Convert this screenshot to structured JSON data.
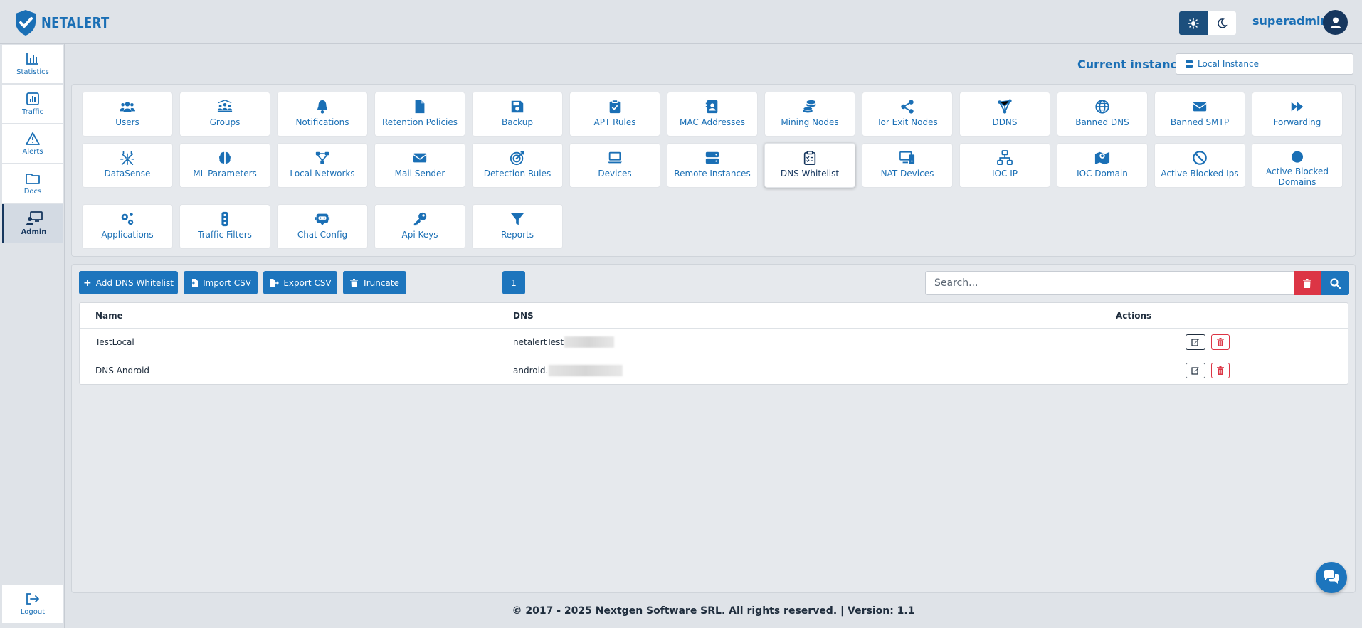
{
  "app": {
    "logo_text": "NETALERT"
  },
  "header": {
    "username": "superadmin"
  },
  "sidebar": {
    "items": [
      {
        "label": "Statistics",
        "icon": "bar-chart-icon"
      },
      {
        "label": "Traffic",
        "icon": "line-chart-icon"
      },
      {
        "label": "Alerts",
        "icon": "warning-icon"
      },
      {
        "label": "Docs",
        "icon": "folder-icon"
      },
      {
        "label": "Admin",
        "icon": "admin-icon",
        "active": true
      }
    ],
    "logout_label": "Logout"
  },
  "instance": {
    "label": "Current instance:",
    "value": "Local Instance"
  },
  "tiles": [
    {
      "label": "Users",
      "icon": "users-icon"
    },
    {
      "label": "Groups",
      "icon": "groups-icon"
    },
    {
      "label": "Notifications",
      "icon": "bell-icon"
    },
    {
      "label": "Retention Policies",
      "icon": "file-icon"
    },
    {
      "label": "Backup",
      "icon": "save-icon"
    },
    {
      "label": "APT Rules",
      "icon": "clipboard-icon"
    },
    {
      "label": "MAC Addresses",
      "icon": "address-book-icon"
    },
    {
      "label": "Mining Nodes",
      "icon": "coins-icon"
    },
    {
      "label": "Tor Exit Nodes",
      "icon": "share-icon"
    },
    {
      "label": "DDNS",
      "icon": "nodes-icon"
    },
    {
      "label": "Banned DNS",
      "icon": "globe-icon"
    },
    {
      "label": "Banned SMTP",
      "icon": "envelope-icon"
    },
    {
      "label": "Forwarding",
      "icon": "forward-icon"
    },
    {
      "label": "DataSense",
      "icon": "sparkle-icon"
    },
    {
      "label": "ML Parameters",
      "icon": "brain-icon"
    },
    {
      "label": "Local Networks",
      "icon": "network-icon"
    },
    {
      "label": "Mail Sender",
      "icon": "envelope-icon"
    },
    {
      "label": "Detection Rules",
      "icon": "target-icon"
    },
    {
      "label": "Devices",
      "icon": "laptop-icon"
    },
    {
      "label": "Remote Instances",
      "icon": "server-icon"
    },
    {
      "label": "DNS Whitelist",
      "icon": "clipboard-check-icon",
      "active": true
    },
    {
      "label": "NAT Devices",
      "icon": "desktop-icon"
    },
    {
      "label": "IOC IP",
      "icon": "sitemap-icon"
    },
    {
      "label": "IOC Domain",
      "icon": "map-icon"
    },
    {
      "label": "Active Blocked Ips",
      "icon": "ban-icon"
    },
    {
      "label": "Active Blocked Domains",
      "icon": "circle-icon"
    },
    {
      "label": "Applications",
      "icon": "cogs-icon"
    },
    {
      "label": "Traffic Filters",
      "icon": "traffic-light-icon"
    },
    {
      "label": "Chat Config",
      "icon": "robot-icon"
    },
    {
      "label": "Api Keys",
      "icon": "key-icon"
    },
    {
      "label": "Reports",
      "icon": "filter-icon"
    }
  ],
  "toolbar": {
    "add_label": "Add DNS Whitelist",
    "import_label": "Import CSV",
    "export_label": "Export CSV",
    "truncate_label": "Truncate",
    "page": "1",
    "search_placeholder": "Search..."
  },
  "table": {
    "headers": {
      "name": "Name",
      "dns": "DNS",
      "actions": "Actions"
    },
    "rows": [
      {
        "name": "TestLocal",
        "dns": "netalertTest"
      },
      {
        "name": "DNS Android",
        "dns": "android."
      }
    ]
  },
  "footer": {
    "text": "© 2017 - 2025 Nextgen Software SRL. All rights reserved. | Version: 1.1"
  },
  "colors": {
    "primary": "#1d75bd",
    "navy": "#17375e",
    "danger": "#dc3545",
    "background": "#dfe3e8"
  }
}
